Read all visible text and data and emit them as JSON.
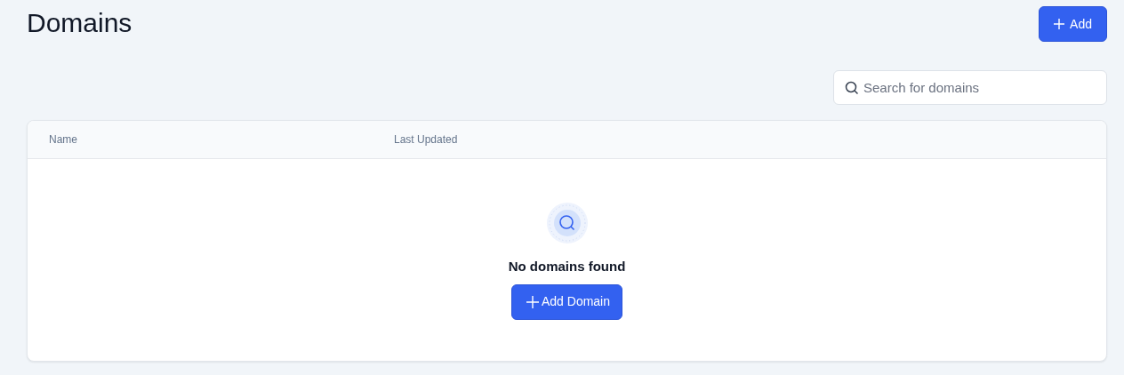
{
  "page": {
    "title": "Domains",
    "add_button": "Add"
  },
  "search": {
    "placeholder": "Search for domains"
  },
  "table": {
    "columns": [
      "Name",
      "Last Updated"
    ],
    "empty_state": {
      "message": "No domains found",
      "button": "Add Domain"
    }
  }
}
